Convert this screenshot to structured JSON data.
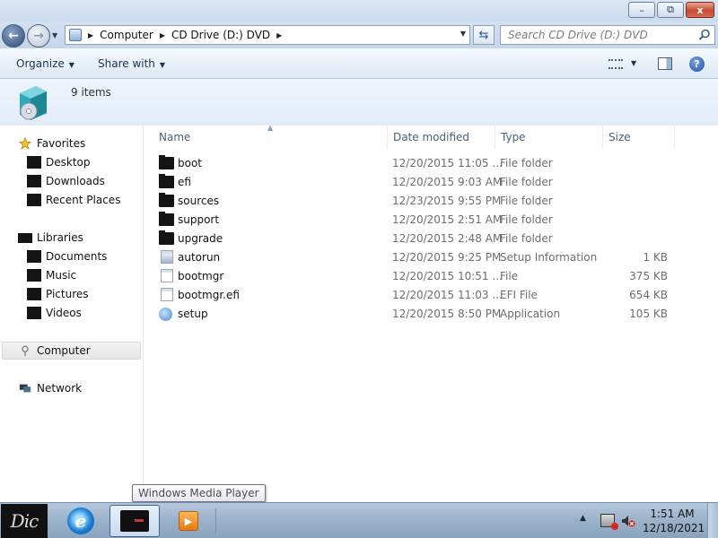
{
  "window": {
    "minimize_glyph": "–",
    "maximize_glyph": "⧉",
    "close_glyph": "x"
  },
  "address": {
    "crumbs": [
      "Computer",
      "CD Drive (D:) DVD"
    ]
  },
  "search": {
    "placeholder": "Search CD Drive (D:) DVD"
  },
  "toolbar": {
    "organize_label": "Organize",
    "share_label": "Share with"
  },
  "details": {
    "item_count": "9 items"
  },
  "nav": {
    "favorites": "Favorites",
    "favorites_items": [
      "Desktop",
      "Downloads",
      "Recent Places"
    ],
    "libraries": "Libraries",
    "libraries_items": [
      "Documents",
      "Music",
      "Pictures",
      "Videos"
    ],
    "computer": "Computer",
    "network": "Network"
  },
  "columns": {
    "name": "Name",
    "date": "Date modified",
    "type": "Type",
    "size": "Size"
  },
  "files": [
    {
      "name": "boot",
      "date": "12/20/2015 11:05 ...",
      "type": "File folder",
      "size": "",
      "icon": "folder-icon"
    },
    {
      "name": "efi",
      "date": "12/20/2015 9:03 AM",
      "type": "File folder",
      "size": "",
      "icon": "folder-icon"
    },
    {
      "name": "sources",
      "date": "12/23/2015 9:55 PM",
      "type": "File folder",
      "size": "",
      "icon": "folder-icon"
    },
    {
      "name": "support",
      "date": "12/20/2015 2:51 AM",
      "type": "File folder",
      "size": "",
      "icon": "folder-icon"
    },
    {
      "name": "upgrade",
      "date": "12/20/2015 2:48 AM",
      "type": "File folder",
      "size": "",
      "icon": "folder-icon"
    },
    {
      "name": "autorun",
      "date": "12/20/2015 9:25 PM",
      "type": "Setup Information",
      "size": "1 KB",
      "icon": "setup-info-icon"
    },
    {
      "name": "bootmgr",
      "date": "12/20/2015 10:51 ...",
      "type": "File",
      "size": "375 KB",
      "icon": "file-icon"
    },
    {
      "name": "bootmgr.efi",
      "date": "12/20/2015 11:03 ...",
      "type": "EFI File",
      "size": "654 KB",
      "icon": "file-icon"
    },
    {
      "name": "setup",
      "date": "12/20/2015 8:50 PM",
      "type": "Application",
      "size": "105 KB",
      "icon": "setup-app-icon"
    }
  ],
  "tooltip": {
    "text": "Windows Media Player"
  },
  "taskbar": {
    "start_text": "Dic",
    "ie_glyph": "e",
    "wmp_glyph": "▶",
    "time": "1:51 AM",
    "date": "12/18/2021"
  }
}
